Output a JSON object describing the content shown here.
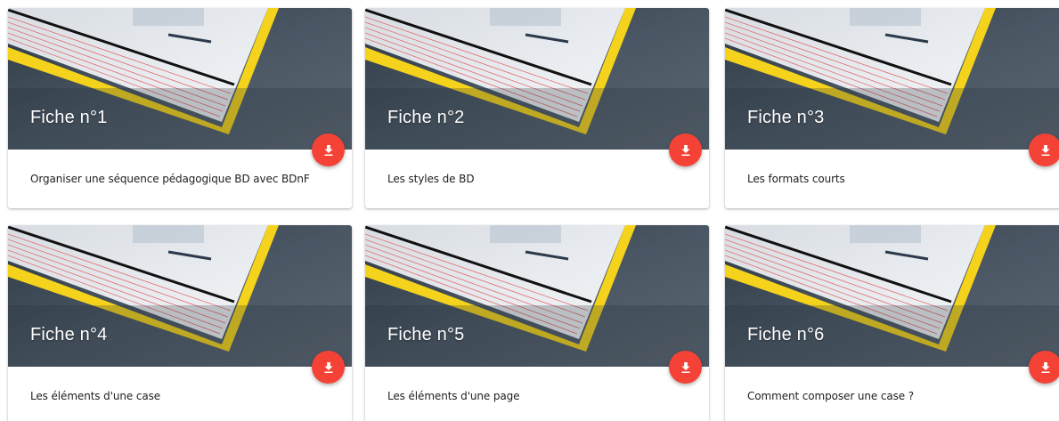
{
  "cards": [
    {
      "title": "Fiche n°1",
      "description": "Organiser une séquence pédagogique BD avec BDnF"
    },
    {
      "title": "Fiche n°2",
      "description": "Les styles de BD"
    },
    {
      "title": "Fiche n°3",
      "description": "Les formats courts"
    },
    {
      "title": "Fiche n°4",
      "description": "Les éléments d'une case"
    },
    {
      "title": "Fiche n°5",
      "description": "Les éléments d'une page"
    },
    {
      "title": "Fiche n°6",
      "description": "Comment composer une case ?"
    }
  ],
  "download_icon": "download-icon",
  "colors": {
    "fab": "#f44336",
    "page_edge": "#f5d31c",
    "background": "#3e4a56"
  }
}
